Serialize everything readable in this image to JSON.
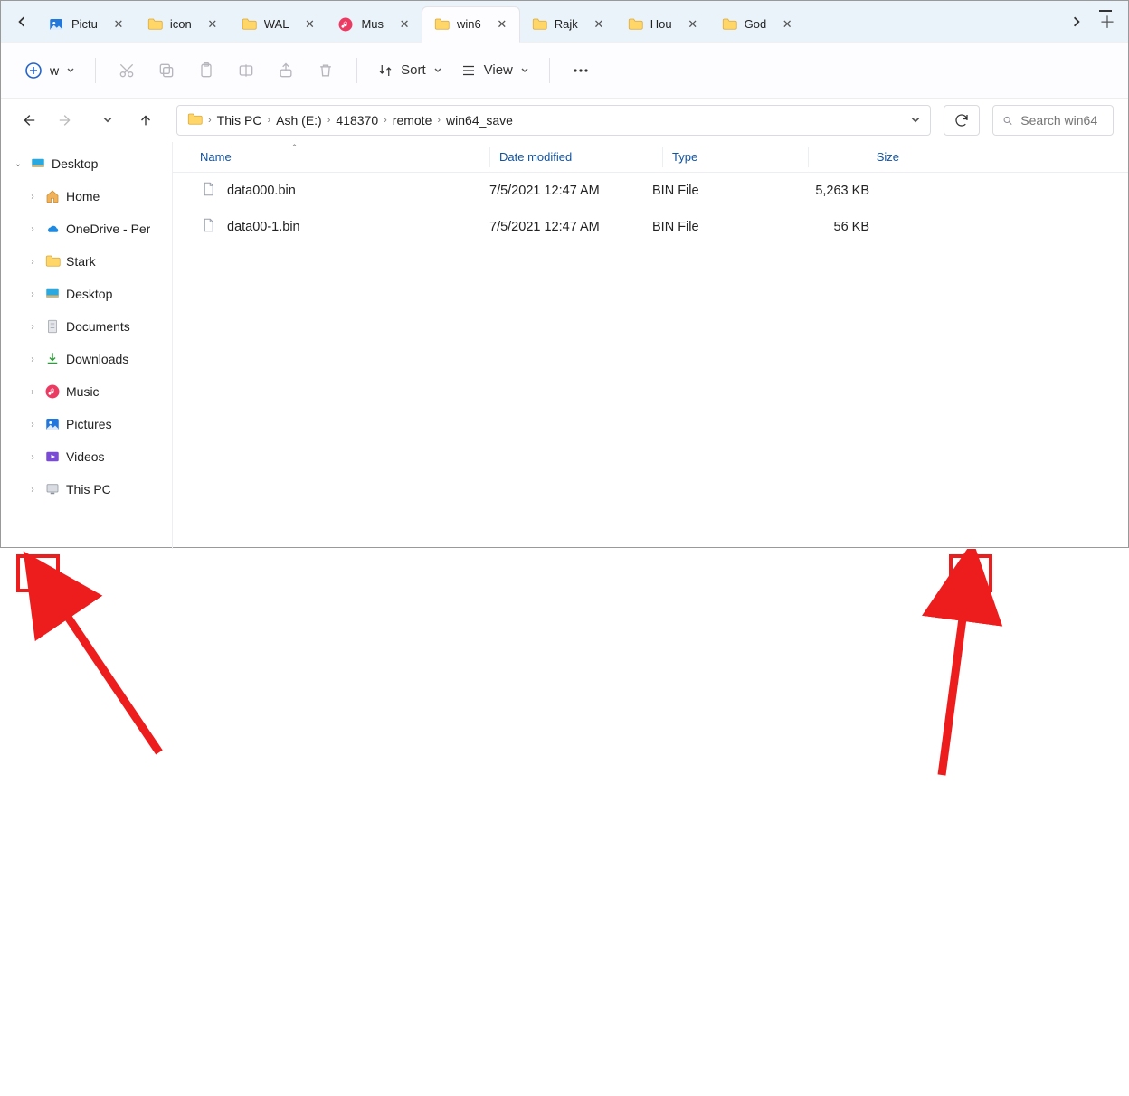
{
  "tabstrip": {
    "scroll": true,
    "tabs": [
      {
        "icon": "picture",
        "label": "Pictu"
      },
      {
        "icon": "folder",
        "label": "icon"
      },
      {
        "icon": "folder",
        "label": "WAL"
      },
      {
        "icon": "music",
        "label": "Mus"
      },
      {
        "icon": "folder",
        "label": "win6",
        "active": true
      },
      {
        "icon": "folder",
        "label": "Rajk"
      },
      {
        "icon": "folder",
        "label": "Hou"
      },
      {
        "icon": "folder",
        "label": "God"
      }
    ]
  },
  "toolbar": {
    "new_label": "",
    "sort_label": "Sort",
    "view_label": "View"
  },
  "breadcrumb": {
    "segments": [
      "This PC",
      "Ash (E:)",
      "418370",
      "remote",
      "win64_save"
    ]
  },
  "search": {
    "placeholder": "Search win64"
  },
  "sidebar": {
    "root": "Desktop",
    "items": [
      {
        "icon": "home",
        "label": "Home"
      },
      {
        "icon": "onedrive",
        "label": "OneDrive - Per"
      },
      {
        "icon": "folder",
        "label": "Stark"
      },
      {
        "icon": "desktop",
        "label": "Desktop"
      },
      {
        "icon": "documents",
        "label": "Documents"
      },
      {
        "icon": "downloads",
        "label": "Downloads"
      },
      {
        "icon": "music",
        "label": "Music"
      },
      {
        "icon": "pictures",
        "label": "Pictures"
      },
      {
        "icon": "videos",
        "label": "Videos"
      },
      {
        "icon": "pc",
        "label": "This PC"
      }
    ]
  },
  "columns": {
    "name": "Name",
    "date": "Date modified",
    "type": "Type",
    "size": "Size",
    "sorted": "name",
    "dir": "asc"
  },
  "files": [
    {
      "name": "data000.bin",
      "date": "7/5/2021 12:47 AM",
      "type": "BIN File",
      "size": "5,263 KB"
    },
    {
      "name": "data00-1.bin",
      "date": "7/5/2021 12:47 AM",
      "type": "BIN File",
      "size": "56 KB"
    }
  ]
}
